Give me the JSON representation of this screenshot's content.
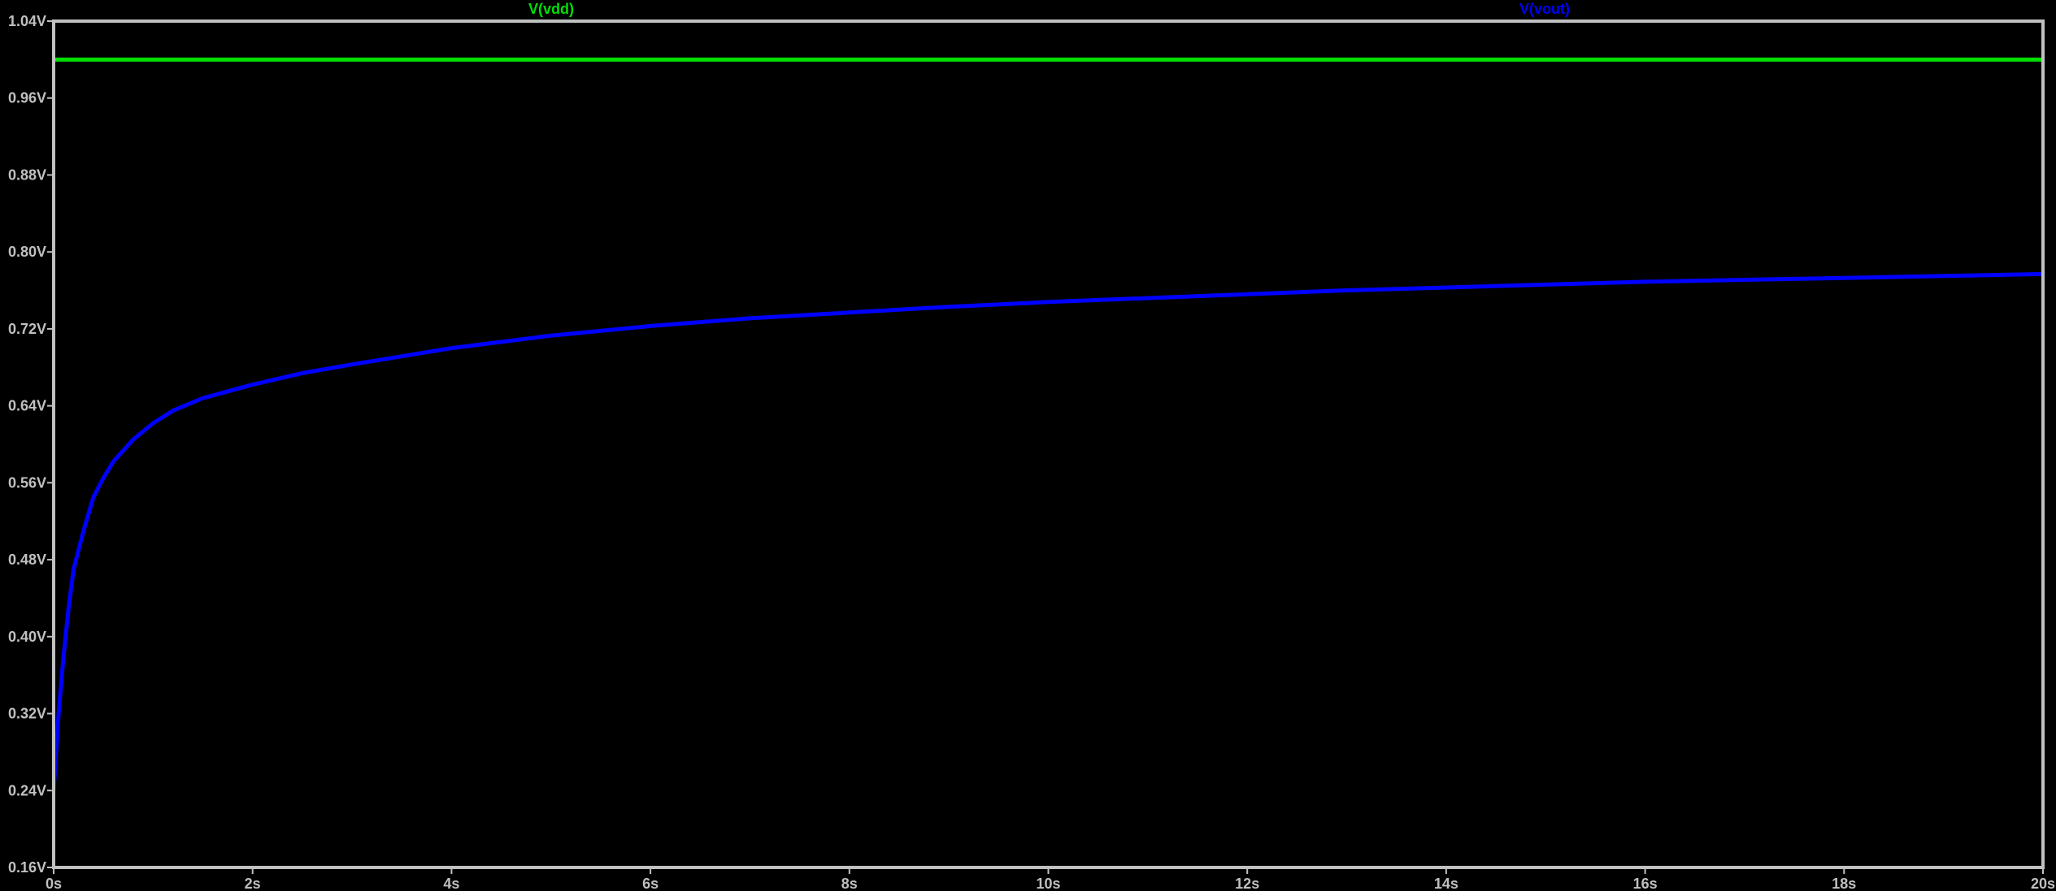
{
  "chart_data": {
    "type": "line",
    "title": "",
    "xlabel": "",
    "ylabel": "",
    "xlim": [
      0,
      20
    ],
    "ylim": [
      0.16,
      1.04
    ],
    "grid": false,
    "background": "#000000",
    "axis_color": "#c0c0c0",
    "x_ticks": [
      0,
      2,
      4,
      6,
      8,
      10,
      12,
      14,
      16,
      18,
      20
    ],
    "x_tick_labels": [
      "0s",
      "2s",
      "4s",
      "6s",
      "8s",
      "10s",
      "12s",
      "14s",
      "16s",
      "18s",
      "20s"
    ],
    "y_ticks": [
      0.16,
      0.24,
      0.32,
      0.4,
      0.48,
      0.56,
      0.64,
      0.72,
      0.8,
      0.88,
      0.96,
      1.04
    ],
    "y_tick_labels": [
      "0.16V",
      "0.24V",
      "0.32V",
      "0.40V",
      "0.48V",
      "0.56V",
      "0.64V",
      "0.72V",
      "0.80V",
      "0.88V",
      "0.96V",
      "1.04V"
    ],
    "series": [
      {
        "name": "V(vdd)",
        "color": "#00e000",
        "x": [
          0,
          20
        ],
        "y": [
          1.0,
          1.0
        ]
      },
      {
        "name": "V(vout)",
        "color": "#0000ff",
        "x": [
          0,
          0.05,
          0.1,
          0.15,
          0.2,
          0.3,
          0.4,
          0.5,
          0.6,
          0.8,
          1.0,
          1.2,
          1.5,
          2.0,
          2.5,
          3.0,
          4.0,
          5.0,
          6.0,
          7.0,
          8.0,
          9.0,
          10.0,
          11.0,
          12.0,
          13.0,
          14.0,
          15.0,
          16.0,
          17.0,
          18.0,
          19.0,
          20.0
        ],
        "y": [
          0.24,
          0.32,
          0.38,
          0.43,
          0.47,
          0.51,
          0.545,
          0.565,
          0.582,
          0.605,
          0.622,
          0.635,
          0.648,
          0.662,
          0.674,
          0.683,
          0.7,
          0.713,
          0.723,
          0.731,
          0.737,
          0.743,
          0.748,
          0.752,
          0.756,
          0.76,
          0.763,
          0.766,
          0.769,
          0.771,
          0.773,
          0.775,
          0.777
        ]
      }
    ]
  }
}
